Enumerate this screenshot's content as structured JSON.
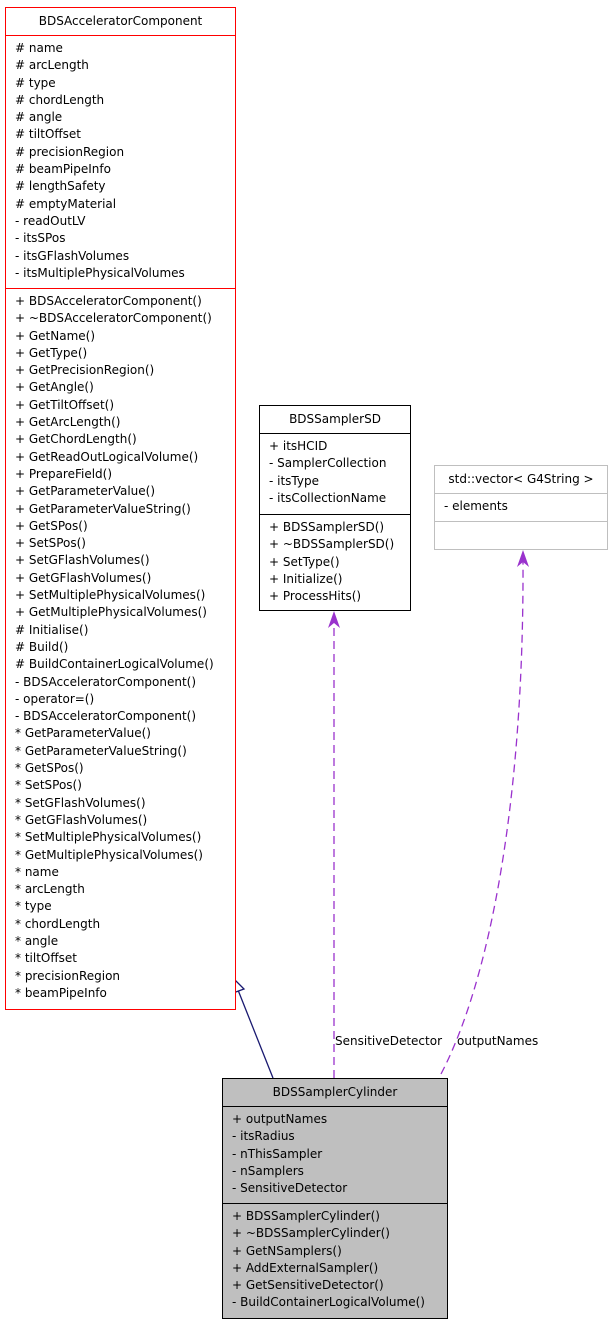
{
  "classes": [
    {
      "id": "acc",
      "name": "BDSAcceleratorComponent",
      "attributes": [
        "# name",
        "# arcLength",
        "# type",
        "# chordLength",
        "# angle",
        "# tiltOffset",
        "# precisionRegion",
        "# beamPipeInfo",
        "# lengthSafety",
        "# emptyMaterial",
        "- readOutLV",
        "- itsSPos",
        "- itsGFlashVolumes",
        "- itsMultiplePhysicalVolumes"
      ],
      "methods": [
        "+ BDSAcceleratorComponent()",
        "+ ~BDSAcceleratorComponent()",
        "+ GetName()",
        "+ GetType()",
        "+ GetPrecisionRegion()",
        "+ GetAngle()",
        "+ GetTiltOffset()",
        "+ GetArcLength()",
        "+ GetChordLength()",
        "+ GetReadOutLogicalVolume()",
        "+ PrepareField()",
        "+ GetParameterValue()",
        "+ GetParameterValueString()",
        "+ GetSPos()",
        "+ SetSPos()",
        "+ SetGFlashVolumes()",
        "+ GetGFlashVolumes()",
        "+ SetMultiplePhysicalVolumes()",
        "+ GetMultiplePhysicalVolumes()",
        "# Initialise()",
        "# Build()",
        "# BuildContainerLogicalVolume()",
        "- BDSAcceleratorComponent()",
        "- operator=()",
        "- BDSAcceleratorComponent()",
        "* GetParameterValue()",
        "* GetParameterValueString()",
        "* GetSPos()",
        "* SetSPos()",
        "* SetGFlashVolumes()",
        "* GetGFlashVolumes()",
        "* SetMultiplePhysicalVolumes()",
        "* GetMultiplePhysicalVolumes()",
        "* name",
        "* arcLength",
        "* type",
        "* chordLength",
        "* angle",
        "* tiltOffset",
        "* precisionRegion",
        "* beamPipeInfo"
      ]
    },
    {
      "id": "sd",
      "name": "BDSSamplerSD",
      "attributes": [
        "+ itsHCID",
        "- SamplerCollection",
        "- itsType",
        "- itsCollectionName"
      ],
      "methods": [
        "+ BDSSamplerSD()",
        "+ ~BDSSamplerSD()",
        "+ SetType()",
        "+ Initialize()",
        "+ ProcessHits()"
      ]
    },
    {
      "id": "vec",
      "name": "std::vector< G4String >",
      "attributes": [
        "- elements"
      ],
      "methods": []
    },
    {
      "id": "cyl",
      "name": "BDSSamplerCylinder",
      "attributes": [
        "+ outputNames",
        "- itsRadius",
        "- nThisSampler",
        "- nSamplers",
        "- SensitiveDetector"
      ],
      "methods": [
        "+ BDSSamplerCylinder()",
        "+ ~BDSSamplerCylinder()",
        "+ GetNSamplers()",
        "+ AddExternalSampler()",
        "+ GetSensitiveDetector()",
        "- BuildContainerLogicalVolume()"
      ]
    }
  ],
  "edges": [
    {
      "from": "BDSSamplerCylinder",
      "to": "BDSAcceleratorComponent",
      "kind": "inheritance",
      "label": ""
    },
    {
      "from": "BDSSamplerCylinder",
      "to": "BDSSamplerSD",
      "kind": "usage",
      "label": "SensitiveDetector"
    },
    {
      "from": "BDSSamplerCylinder",
      "to": "std::vector< G4String >",
      "kind": "usage",
      "label": "outputNames"
    }
  ],
  "colors": {
    "inheritance": "#191970",
    "usage": "#9a32cd",
    "linked_border": "#ff0000",
    "external_border": "#bfbfbf",
    "focus_fill": "#bfbfbf"
  }
}
